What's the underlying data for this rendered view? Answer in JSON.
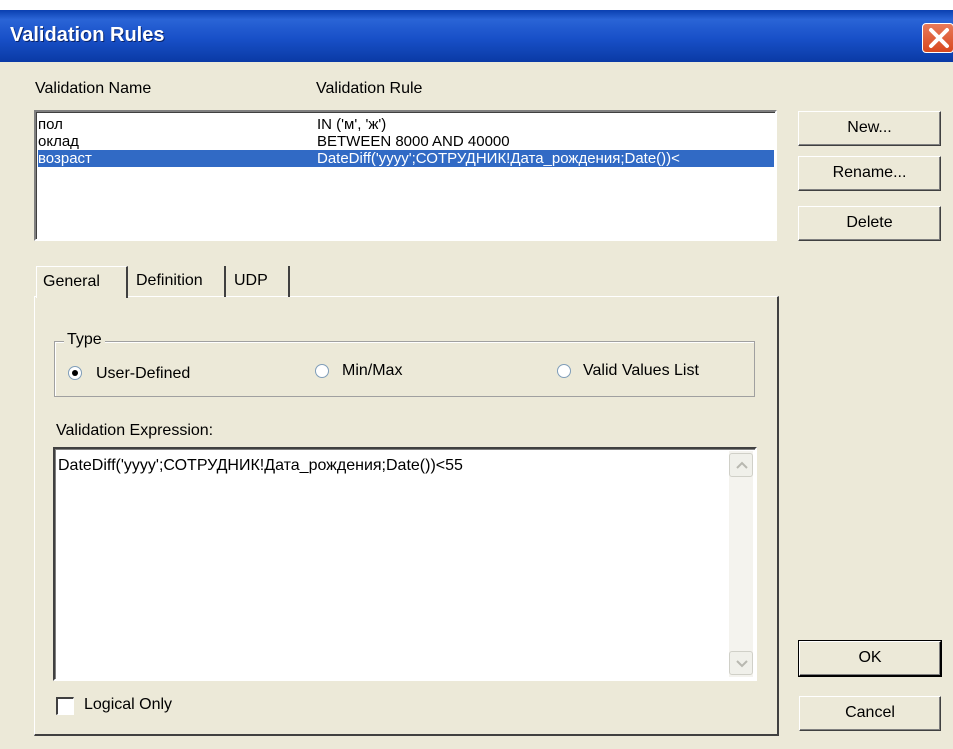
{
  "window": {
    "title": "Validation Rules"
  },
  "list": {
    "headers": {
      "name": "Validation Name",
      "rule": "Validation Rule"
    },
    "rows": [
      {
        "name": "пол",
        "rule": "IN ('м', 'ж')",
        "selected": false
      },
      {
        "name": "оклад",
        "rule": "BETWEEN 8000 AND 40000",
        "selected": false
      },
      {
        "name": "возраст",
        "rule": "DateDiff('yyyy';СОТРУДНИК!Дата_рождения;Date())<",
        "selected": true
      }
    ]
  },
  "buttons": {
    "new": "New...",
    "rename": "Rename...",
    "delete": "Delete",
    "ok": "OK",
    "cancel": "Cancel"
  },
  "tabs": [
    {
      "label": "General",
      "active": true
    },
    {
      "label": "Definition",
      "active": false
    },
    {
      "label": "UDP",
      "active": false
    }
  ],
  "type": {
    "label": "Type",
    "options": [
      {
        "label": "User-Defined",
        "checked": true
      },
      {
        "label": "Min/Max",
        "checked": false
      },
      {
        "label": "Valid Values List",
        "checked": false
      }
    ]
  },
  "expression": {
    "label": "Validation Expression:",
    "value": "DateDiff('yyyy';СОТРУДНИК!Дата_рождения;Date())<55"
  },
  "logical_only": {
    "label": "Logical Only",
    "checked": false
  },
  "colors": {
    "titlebar": "#0a3fb0",
    "selection": "#316ac5",
    "dialog": "#ece9d8"
  },
  "icons": {
    "close": "close-icon",
    "scroll_up": "chevron-up-icon",
    "scroll_down": "chevron-down-icon"
  }
}
